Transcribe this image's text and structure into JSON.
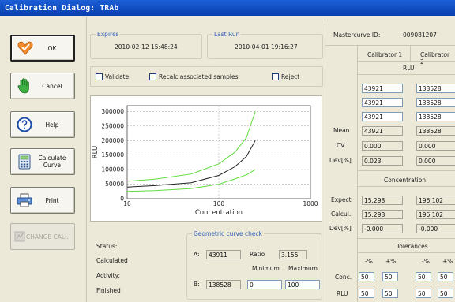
{
  "window": {
    "title": "Calibration Dialog:  TRAb"
  },
  "buttons": {
    "ok": "OK",
    "cancel": "Cancel",
    "help": "Help",
    "calculate_curve": "Calculate Curve",
    "print": "Print",
    "change_cali": "CHANGE CALI."
  },
  "expires": {
    "title": "Expires",
    "value": "2010-02-12 15:48:24"
  },
  "last_run": {
    "title": "Last Run",
    "value": "2010-04-01 19:16:27"
  },
  "checks": {
    "validate": "Validate",
    "recalc": "Recalc associated samples",
    "reject": "Reject"
  },
  "chart_data": {
    "type": "line",
    "xlabel": "Concentration",
    "ylabel": "RLU",
    "xscale": "log",
    "xlim": [
      10,
      1000
    ],
    "ylim": [
      0,
      320000
    ],
    "xticks": [
      "10",
      "100",
      "1000"
    ],
    "yticks": [
      "0",
      "50000",
      "100000",
      "150000",
      "200000",
      "250000",
      "300000"
    ],
    "grid": true,
    "series": [
      {
        "color": "#5fdc3c",
        "x": [
          10,
          20,
          50,
          100,
          150,
          200,
          250
        ],
        "y": [
          60000,
          67000,
          85000,
          120000,
          160000,
          210000,
          300000
        ]
      },
      {
        "color": "#222222",
        "x": [
          10,
          20,
          50,
          100,
          150,
          200,
          250
        ],
        "y": [
          40000,
          45000,
          55000,
          80000,
          110000,
          145000,
          200000
        ]
      },
      {
        "color": "#5fdc3c",
        "x": [
          10,
          20,
          50,
          100,
          150,
          200,
          250
        ],
        "y": [
          25000,
          28000,
          35000,
          50000,
          68000,
          82000,
          100000
        ]
      }
    ]
  },
  "status": {
    "status_label": "Status:",
    "status_value": "Calculated",
    "activity_label": "Activity:",
    "activity_value": "Finished"
  },
  "geo_check": {
    "title": "Geometric curve check",
    "a_label": "A:",
    "a_value": "43911",
    "ratio_label": "Ratio",
    "ratio_value": "3.155",
    "min_label": "Minimum",
    "max_label": "Maximum",
    "b_label": "B:",
    "b_value": "138528",
    "min_value": "0",
    "max_value": "100"
  },
  "right": {
    "mastercurve_label": "Mastercurve ID:",
    "mastercurve_value": "009081207",
    "cal1": "Calibrator 1",
    "cal2": "Calibrator 2",
    "rlu_header": "RLU",
    "rlu_rows": [
      [
        "43921",
        "138528"
      ],
      [
        "43921",
        "138528"
      ],
      [
        "43921",
        "138528"
      ]
    ],
    "mean_label": "Mean",
    "mean": [
      "43921",
      "138528"
    ],
    "cv_label": "CV",
    "cv": [
      "0.000",
      "0.000"
    ],
    "dev_label": "Dev[%]",
    "dev": [
      "0.023",
      "0.000"
    ],
    "conc_header": "Concentration",
    "expect_label": "Expect",
    "expect": [
      "15.298",
      "196.102"
    ],
    "calcul_label": "Calcul.",
    "calcul": [
      "15.298",
      "196.102"
    ],
    "dev2_label": "Dev[%]",
    "dev2": [
      "-0.000",
      "-0.000"
    ],
    "tol_header": "Tolerances",
    "minus_pct": "-%",
    "plus_pct": "+%",
    "conc_label": "Conc.",
    "conc_tol": [
      "50",
      "50",
      "50",
      "50"
    ],
    "rlu_label": "RLU",
    "rlu_tol": [
      "50",
      "50",
      "50",
      "50"
    ]
  }
}
